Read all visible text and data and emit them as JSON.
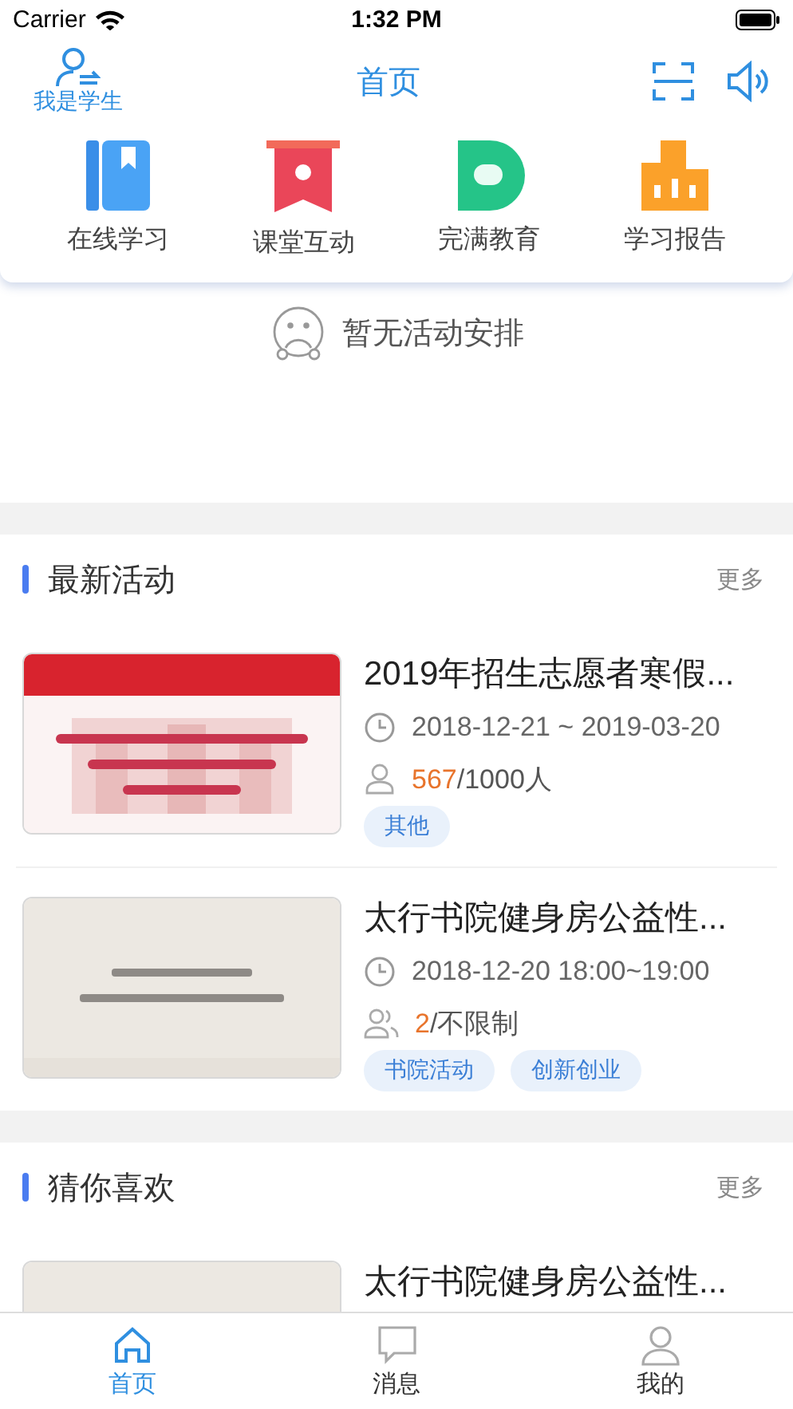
{
  "status_bar": {
    "carrier": "Carrier",
    "time": "1:32 PM"
  },
  "nav_bar": {
    "role_label": "我是学生",
    "title": "首页"
  },
  "quick_actions": [
    {
      "kind": "book",
      "label": "在线学习"
    },
    {
      "kind": "banner",
      "label": "课堂互动"
    },
    {
      "kind": "letter",
      "label": "完满教育"
    },
    {
      "kind": "chart",
      "label": "学习报告"
    }
  ],
  "empty_state": {
    "text": "暂无活动安排"
  },
  "sections": [
    {
      "title": "最新活动",
      "more": "更多",
      "items": [
        {
          "title": "2019年招生志愿者寒假...",
          "time": "2018-12-21 ~ 2019-03-20",
          "count": "567",
          "capacity": "/1000人",
          "tags": [
            "其他"
          ]
        },
        {
          "title": "太行书院健身房公益性...",
          "time": "2018-12-20  18:00~19:00",
          "count": "2",
          "capacity": "/不限制",
          "tags": [
            "书院活动",
            "创新创业"
          ]
        }
      ]
    },
    {
      "title": "猜你喜欢",
      "more": "更多",
      "items": [
        {
          "title": "太行书院健身房公益性..."
        }
      ]
    }
  ],
  "tab_bar": [
    {
      "kind": "home",
      "label": "首页",
      "selected": true
    },
    {
      "kind": "message",
      "label": "消息",
      "selected": false
    },
    {
      "kind": "profile",
      "label": "我的",
      "selected": false
    }
  ]
}
